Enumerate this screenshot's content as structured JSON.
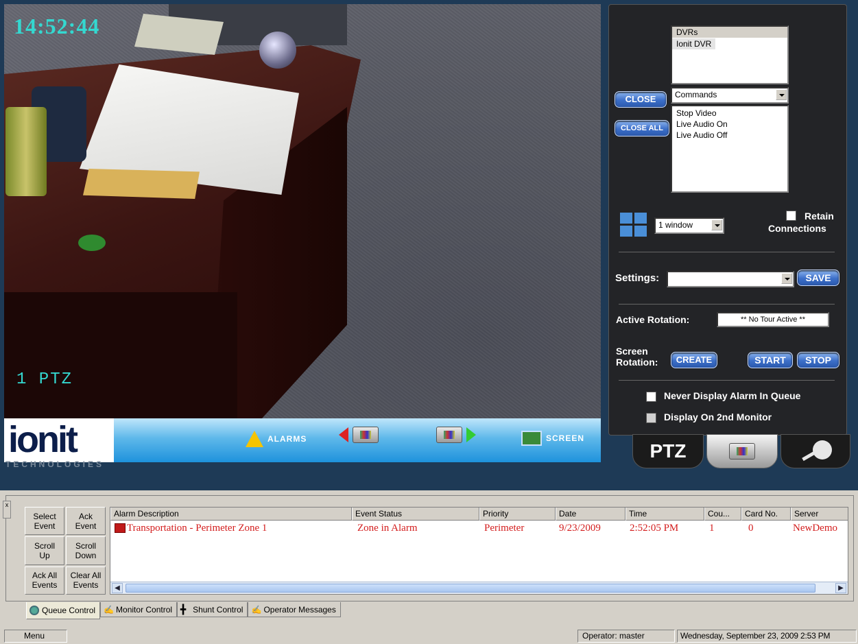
{
  "viewer": {
    "timestamp": "14:52:44",
    "camera_label": "1 PTZ",
    "toolbar": {
      "logo": "ionit",
      "logo_sub": "TECHNOLOGIES",
      "alarms_label": "ALARMS",
      "screen_label": "SCREEN"
    }
  },
  "panel": {
    "dvr_list": {
      "header": "DVRs",
      "items": [
        "Ionit DVR"
      ]
    },
    "close_label": "CLOSE",
    "close_all_label": "CLOSE ALL",
    "commands_select": "Commands",
    "command_items": [
      "Stop Video",
      "Live Audio On",
      "Live Audio Off"
    ],
    "window_select": "1 window",
    "retain_label_1": "Retain",
    "retain_label_2": "Connections",
    "settings_label": "Settings:",
    "settings_value": "",
    "save_label": "SAVE",
    "active_rotation_label": "Active Rotation:",
    "active_rotation_value": "** No Tour Active **",
    "screen_rotation_label_1": "Screen",
    "screen_rotation_label_2": "Rotation:",
    "create_label": "CREATE",
    "start_label": "START",
    "stop_label": "STOP",
    "never_display_label": "Never Display Alarm In Queue",
    "display_2nd_label": "Display On 2nd Monitor"
  },
  "tabs": {
    "ptz_label": "PTZ"
  },
  "queue": {
    "buttons": [
      [
        "Select",
        "Event"
      ],
      [
        "Ack",
        "Event"
      ],
      [
        "Scroll",
        "Up"
      ],
      [
        "Scroll",
        "Down"
      ],
      [
        "Ack All",
        "Events"
      ],
      [
        "Clear All",
        "Events"
      ]
    ],
    "columns": [
      "Alarm Description",
      "Event Status",
      "Priority",
      "Date",
      "Time",
      "Cou...",
      "Card No.",
      "Server"
    ],
    "rows": [
      {
        "description": "Transportation - Perimeter Zone 1",
        "status": "Zone in Alarm",
        "priority": "Perimeter",
        "date": "9/23/2009",
        "time": "2:52:05 PM",
        "count": "1",
        "card_no": "0",
        "server": "NewDemo"
      }
    ],
    "tabs": [
      "Queue Control",
      "Monitor Control",
      "Shunt Control",
      "Operator Messages"
    ]
  },
  "statusbar": {
    "menu_label": "Menu",
    "operator": "Operator: master",
    "datetime": "Wednesday, September 23, 2009  2:53 PM"
  },
  "colors": {
    "osd": "#34d8d0",
    "alarm_text": "#d31c1c",
    "panel_bg": "#232427"
  }
}
